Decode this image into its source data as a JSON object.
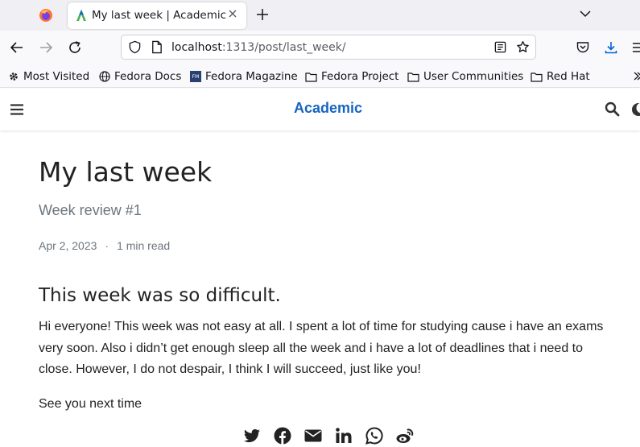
{
  "browser": {
    "tab": {
      "title": "My last week | Academic",
      "favicon": "academic-favicon-icon"
    },
    "url": {
      "host": "localhost",
      "rest": ":1313/post/last_week/"
    },
    "bookmarks": [
      {
        "label": "Most Visited",
        "icon": "gear-icon"
      },
      {
        "label": "Fedora Docs",
        "icon": "globe-icon"
      },
      {
        "label": "Fedora Magazine",
        "icon": "fm-icon"
      },
      {
        "label": "Fedora Project",
        "icon": "folder-icon"
      },
      {
        "label": "User Communities",
        "icon": "folder-icon"
      },
      {
        "label": "Red Hat",
        "icon": "folder-icon"
      }
    ]
  },
  "site": {
    "brand": "Academic",
    "accent_color": "#1565c0"
  },
  "post": {
    "title": "My last week",
    "subtitle": "Week review #1",
    "date": "Apr 2, 2023",
    "separator": "·",
    "reading_time": "1 min read",
    "heading": "This week was so difficult.",
    "paragraphs": [
      "Hi everyone! This week was not easy at all. I spent a lot of time for studying cause i have an exams very soon. Also i didn’t get enough sleep all the week and i have a lot of deadlines that i need to close. However, I do not despair, I think I will succeed, just like you!",
      "See you next time"
    ]
  },
  "share": [
    "twitter-icon",
    "facebook-icon",
    "email-icon",
    "linkedin-icon",
    "whatsapp-icon",
    "weibo-icon"
  ]
}
